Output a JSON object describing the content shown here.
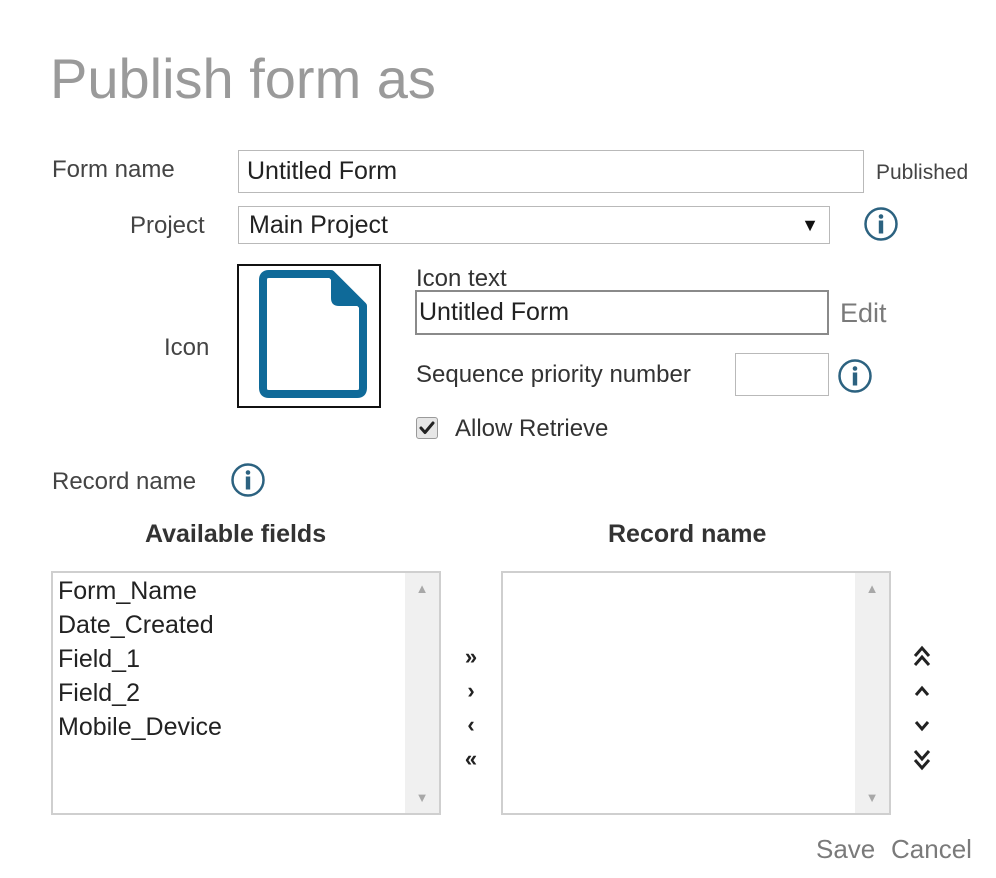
{
  "title": "Publish form as",
  "form_name": {
    "label": "Form name",
    "value": "Untitled Form",
    "status": "Published"
  },
  "project": {
    "label": "Project",
    "selected": "Main Project"
  },
  "icon": {
    "label": "Icon",
    "glyph": "document-icon",
    "color": "#0f6a99"
  },
  "icon_text": {
    "label": "Icon text",
    "value": "Untitled Form",
    "edit_label": "Edit"
  },
  "sequence": {
    "label": "Sequence priority number",
    "value": ""
  },
  "allow_retrieve": {
    "label": "Allow Retrieve",
    "checked": true
  },
  "record_name": {
    "label": "Record name"
  },
  "available_fields": {
    "heading": "Available fields",
    "items": [
      "Form_Name",
      "Date_Created",
      "Field_1",
      "Field_2",
      "Mobile_Device"
    ]
  },
  "record_fields": {
    "heading": "Record name",
    "items": []
  },
  "transfer_buttons": [
    "add-all",
    "add",
    "remove",
    "remove-all"
  ],
  "order_buttons": [
    "move-top",
    "move-up",
    "move-down",
    "move-bottom"
  ],
  "footer": {
    "save_label": "Save",
    "cancel_label": "Cancel"
  },
  "colors": {
    "title": "#9a9a9a",
    "info_icon": "#2c6280",
    "accent": "#0f6a99"
  }
}
